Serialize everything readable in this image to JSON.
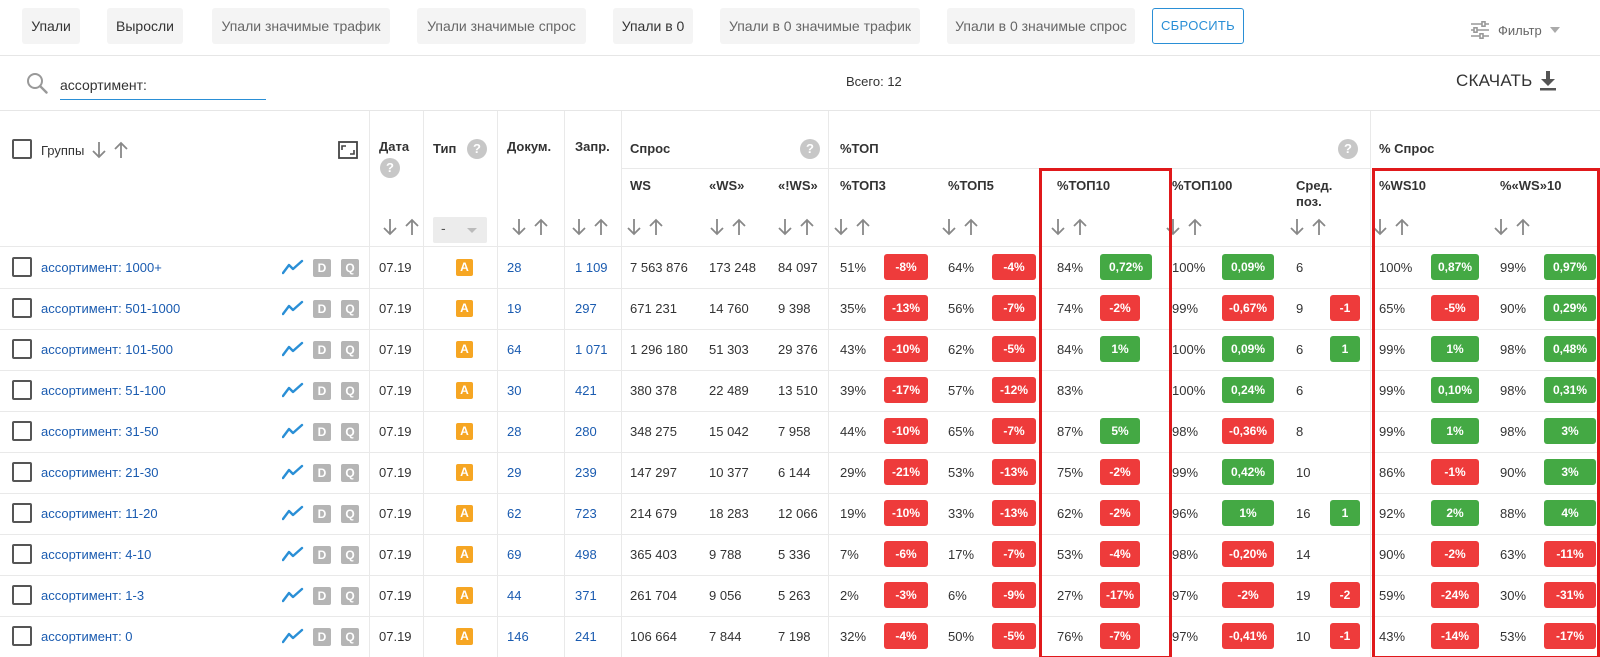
{
  "filters": {
    "chips": [
      "Упали",
      "Выросли",
      "Упали значимые трафик",
      "Упали значимые спрос",
      "Упали в 0",
      "Упали в 0 значимые трафик",
      "Упали в 0 значимые спрос"
    ],
    "reset_label": "СБРОСИТЬ",
    "filter_label": "Фильтр"
  },
  "search": {
    "value": "ассортимент:"
  },
  "total": {
    "label": "Всего:",
    "value": "12"
  },
  "download_label": "СКАЧАТЬ",
  "headers": {
    "groups": "Группы",
    "date": "Дата",
    "type": "Тип",
    "type_select": "-",
    "docs": "Докум.",
    "queries": "Запр.",
    "demand": "Спрос",
    "ws": "WS",
    "qws": "«WS»",
    "eqws": "«!WS»",
    "top": "%ТОП",
    "top3": "%ТОП3",
    "top5": "%ТОП5",
    "top10": "%ТОП10",
    "top100": "%ТОП100",
    "avgpos": "Сред. поз.",
    "demand_pct": "% Спрос",
    "ws10": "%WS10",
    "qws10": "%«WS»10"
  },
  "rows": [
    {
      "name": "ассортимент: 1000+",
      "date": "07.19",
      "type": "A",
      "docs": "28",
      "queries": "1 109",
      "ws": "7 563 876",
      "qws": "173 248",
      "eqws": "84 097",
      "top3": "51%",
      "top3d": "-8%",
      "top5": "64%",
      "top5d": "-4%",
      "top10": "84%",
      "top10d": "0,72%",
      "top100": "100%",
      "top100d": "0,09%",
      "avg": "6",
      "avgd": "",
      "ws10": "100%",
      "ws10d": "0,87%",
      "qws10": "99%",
      "qws10d": "0,97%"
    },
    {
      "name": "ассортимент: 501-1000",
      "date": "07.19",
      "type": "A",
      "docs": "19",
      "queries": "297",
      "ws": "671 231",
      "qws": "14 760",
      "eqws": "9 398",
      "top3": "35%",
      "top3d": "-13%",
      "top5": "56%",
      "top5d": "-7%",
      "top10": "74%",
      "top10d": "-2%",
      "top100": "99%",
      "top100d": "-0,67%",
      "avg": "9",
      "avgd": "-1",
      "ws10": "65%",
      "ws10d": "-5%",
      "qws10": "90%",
      "qws10d": "0,29%"
    },
    {
      "name": "ассортимент: 101-500",
      "date": "07.19",
      "type": "A",
      "docs": "64",
      "queries": "1 071",
      "ws": "1 296 180",
      "qws": "51 303",
      "eqws": "29 376",
      "top3": "43%",
      "top3d": "-10%",
      "top5": "62%",
      "top5d": "-5%",
      "top10": "84%",
      "top10d": "1%",
      "top100": "100%",
      "top100d": "0,09%",
      "avg": "6",
      "avgd": "1",
      "ws10": "99%",
      "ws10d": "1%",
      "qws10": "98%",
      "qws10d": "0,48%"
    },
    {
      "name": "ассортимент: 51-100",
      "date": "07.19",
      "type": "A",
      "docs": "30",
      "queries": "421",
      "ws": "380 378",
      "qws": "22 489",
      "eqws": "13 510",
      "top3": "39%",
      "top3d": "-17%",
      "top5": "57%",
      "top5d": "-12%",
      "top10": "83%",
      "top10d": "",
      "top100": "100%",
      "top100d": "0,24%",
      "avg": "6",
      "avgd": "",
      "ws10": "99%",
      "ws10d": "0,10%",
      "qws10": "98%",
      "qws10d": "0,31%"
    },
    {
      "name": "ассортимент: 31-50",
      "date": "07.19",
      "type": "A",
      "docs": "28",
      "queries": "280",
      "ws": "348 275",
      "qws": "15 042",
      "eqws": "7 958",
      "top3": "44%",
      "top3d": "-10%",
      "top5": "65%",
      "top5d": "-7%",
      "top10": "87%",
      "top10d": "5%",
      "top100": "98%",
      "top100d": "-0,36%",
      "avg": "8",
      "avgd": "",
      "ws10": "99%",
      "ws10d": "1%",
      "qws10": "98%",
      "qws10d": "3%"
    },
    {
      "name": "ассортимент: 21-30",
      "date": "07.19",
      "type": "A",
      "docs": "29",
      "queries": "239",
      "ws": "147 297",
      "qws": "10 377",
      "eqws": "6 144",
      "top3": "29%",
      "top3d": "-21%",
      "top5": "53%",
      "top5d": "-13%",
      "top10": "75%",
      "top10d": "-2%",
      "top100": "99%",
      "top100d": "0,42%",
      "avg": "10",
      "avgd": "",
      "ws10": "86%",
      "ws10d": "-1%",
      "qws10": "90%",
      "qws10d": "3%"
    },
    {
      "name": "ассортимент: 11-20",
      "date": "07.19",
      "type": "A",
      "docs": "62",
      "queries": "723",
      "ws": "214 679",
      "qws": "18 283",
      "eqws": "12 066",
      "top3": "19%",
      "top3d": "-10%",
      "top5": "33%",
      "top5d": "-13%",
      "top10": "62%",
      "top10d": "-2%",
      "top100": "96%",
      "top100d": "1%",
      "avg": "16",
      "avgd": "1",
      "ws10": "92%",
      "ws10d": "2%",
      "qws10": "88%",
      "qws10d": "4%"
    },
    {
      "name": "ассортимент: 4-10",
      "date": "07.19",
      "type": "A",
      "docs": "69",
      "queries": "498",
      "ws": "365 403",
      "qws": "9 788",
      "eqws": "5 336",
      "top3": "7%",
      "top3d": "-6%",
      "top5": "17%",
      "top5d": "-7%",
      "top10": "53%",
      "top10d": "-4%",
      "top100": "98%",
      "top100d": "-0,20%",
      "avg": "14",
      "avgd": "",
      "ws10": "90%",
      "ws10d": "-2%",
      "qws10": "63%",
      "qws10d": "-11%"
    },
    {
      "name": "ассортимент: 1-3",
      "date": "07.19",
      "type": "A",
      "docs": "44",
      "queries": "371",
      "ws": "261 704",
      "qws": "9 056",
      "eqws": "5 263",
      "top3": "2%",
      "top3d": "-3%",
      "top5": "6%",
      "top5d": "-9%",
      "top10": "27%",
      "top10d": "-17%",
      "top100": "97%",
      "top100d": "-2%",
      "avg": "19",
      "avgd": "-2",
      "ws10": "59%",
      "ws10d": "-24%",
      "qws10": "30%",
      "qws10d": "-31%"
    },
    {
      "name": "ассортимент: 0",
      "date": "07.19",
      "type": "A",
      "docs": "146",
      "queries": "241",
      "ws": "106 664",
      "qws": "7 844",
      "eqws": "7 198",
      "top3": "32%",
      "top3d": "-4%",
      "top5": "50%",
      "top5d": "-5%",
      "top10": "76%",
      "top10d": "-7%",
      "top100": "97%",
      "top100d": "-0,41%",
      "avg": "10",
      "avgd": "-1",
      "ws10": "43%",
      "ws10d": "-14%",
      "qws10": "53%",
      "qws10d": "-17%"
    }
  ],
  "colors": {
    "accent": "#2a8fd6",
    "link": "#1a5bb0",
    "negative": "#ee3b3b",
    "positive": "#44a944",
    "highlight": "#e0191b",
    "tag": "#f6a623"
  }
}
